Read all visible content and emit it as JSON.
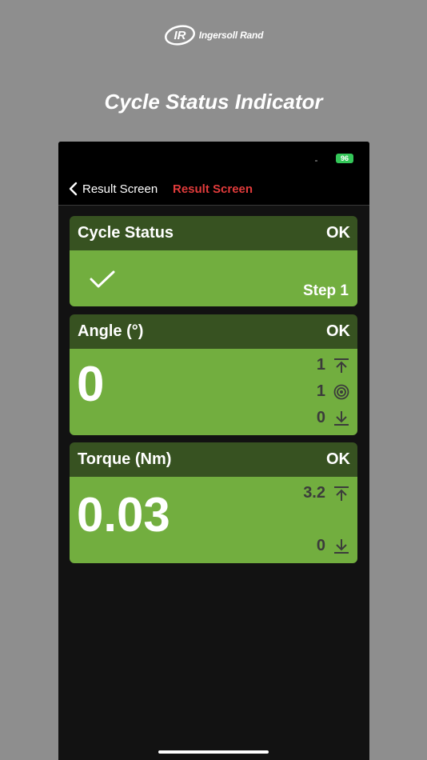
{
  "brand": {
    "mark": "IR",
    "name": "Ingersoll Rand"
  },
  "marketing_title": "Cycle Status Indicator",
  "status_bar": {
    "battery": "96"
  },
  "nav": {
    "back_label": "Result Screen",
    "title": "Result Screen"
  },
  "cards": {
    "cycle": {
      "title": "Cycle Status",
      "status": "OK",
      "step": "Step 1"
    },
    "angle": {
      "title": "Angle (°)",
      "status": "OK",
      "value": "0",
      "upper_limit": "1",
      "target": "1",
      "lower_limit": "0"
    },
    "torque": {
      "title": "Torque (Nm)",
      "status": "OK",
      "value": "0.03",
      "upper_limit": "3.2",
      "lower_limit": "0"
    }
  },
  "colors": {
    "header_green": "#375221",
    "body_green": "#72ae3f",
    "nav_title_red": "#e03b3b",
    "battery_green": "#34c759"
  },
  "icons": {
    "back": "chevron-left-icon",
    "check": "checkmark-icon",
    "upper": "arrow-up-limit-icon",
    "target": "target-icon",
    "lower": "arrow-down-limit-icon"
  }
}
